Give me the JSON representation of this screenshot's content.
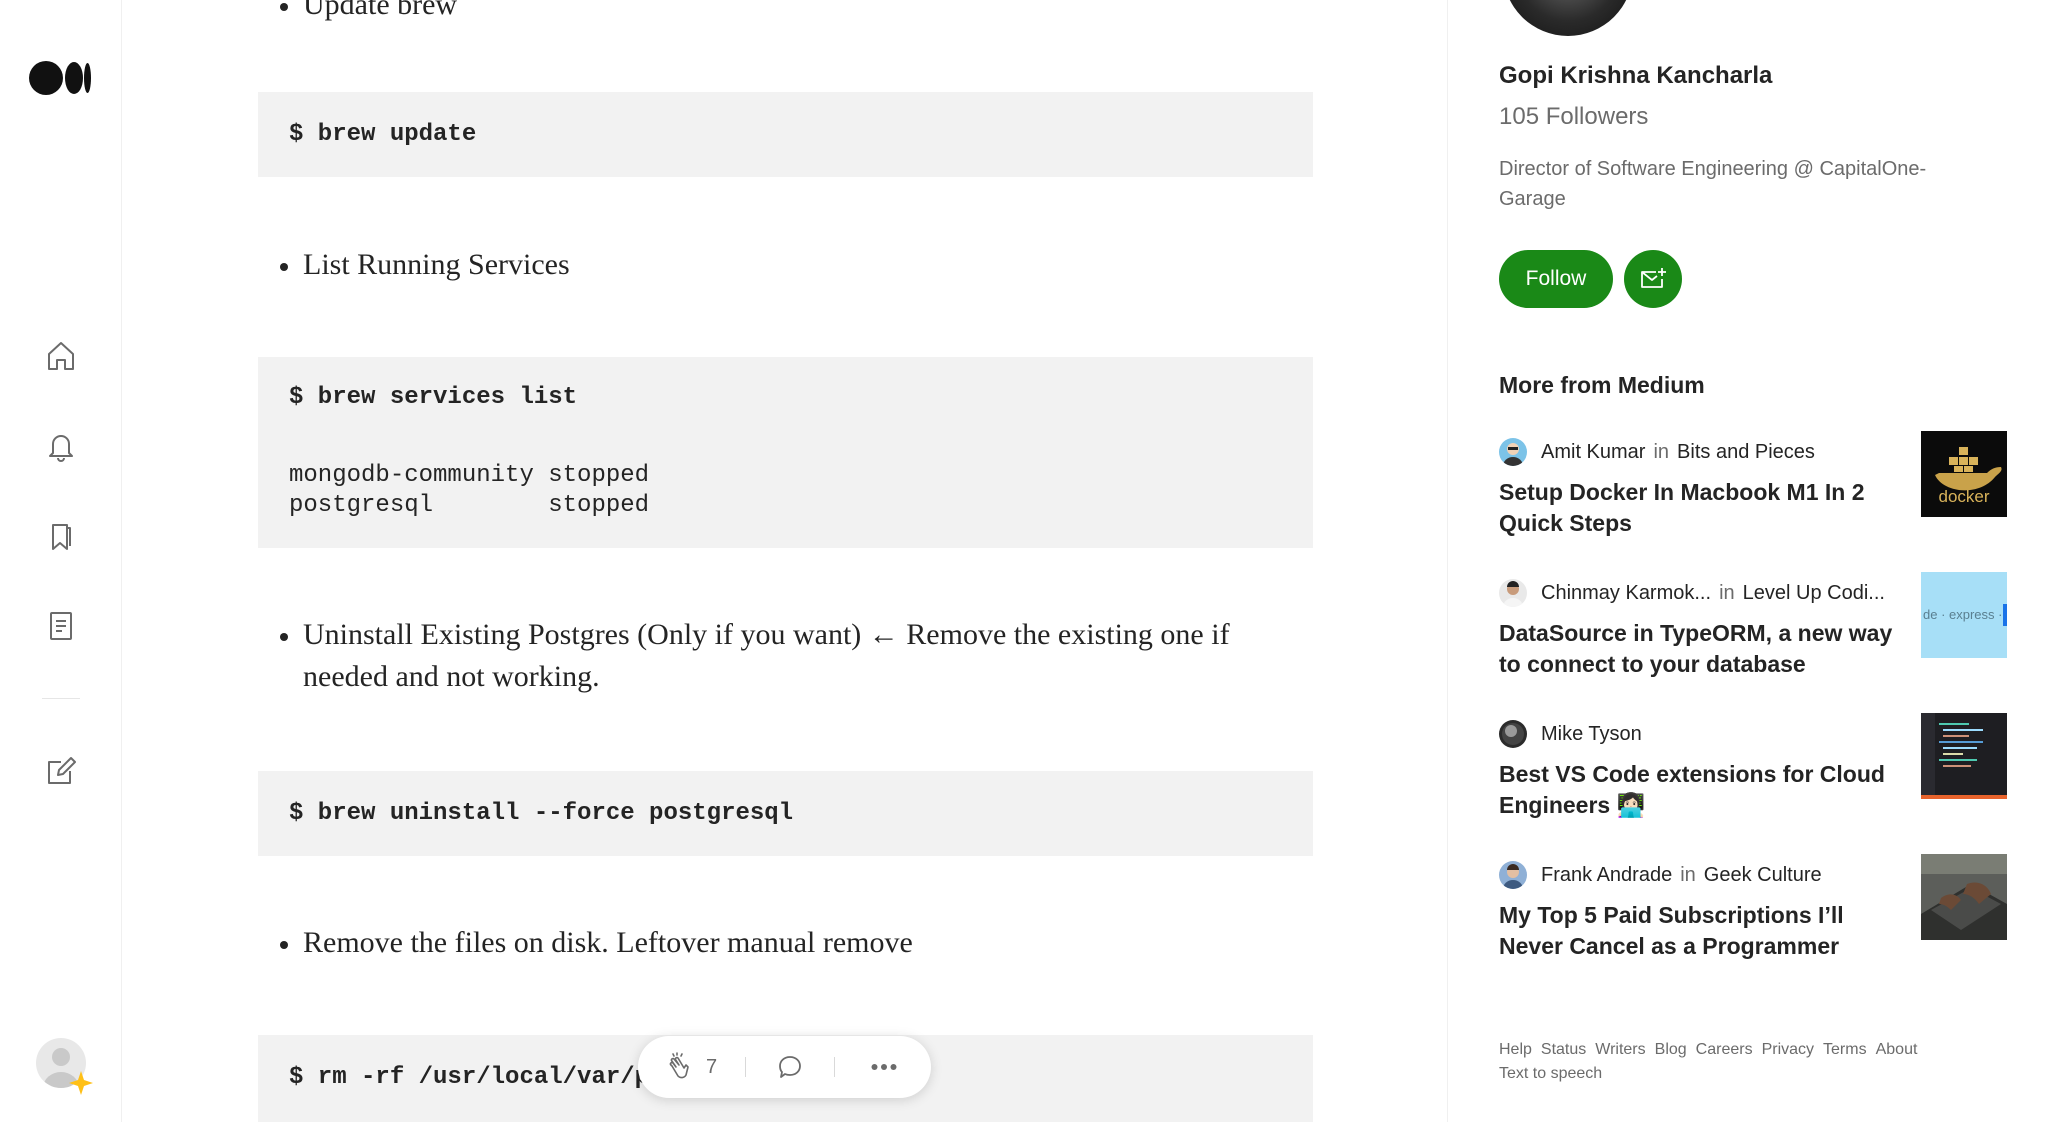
{
  "article": {
    "bullet_update": "Update brew",
    "code_update": "$ brew update",
    "bullet_list": "List Running Services",
    "code_list_cmd": "$ brew services list",
    "code_list_out_1": "mongodb-community stopped",
    "code_list_out_2": "postgresql        stopped",
    "bullet_uninstall": "Uninstall Existing Postgres (Only if you want) ← Remove the existing one if needed and not working.",
    "code_uninstall": "$ brew uninstall --force postgresql",
    "bullet_remove": "Remove the files on disk. Leftover manual remove",
    "code_rm": "$ rm -rf /usr/local/var/p"
  },
  "actionbar": {
    "clap_count": "7"
  },
  "sidebar": {
    "author_name": "Gopi Krishna Kancharla",
    "followers": "105 Followers",
    "bio": "Director of Software Engineering @ CapitalOne-Garage",
    "follow_label": "Follow",
    "more_title": "More from Medium",
    "accent_color": "#1a8917",
    "recommendations": [
      {
        "author": "Amit Kumar",
        "in": "in",
        "publication": "Bits and Pieces",
        "title": "Setup Docker In Macbook M1 In 2 Quick Steps",
        "thumb_text": "docker"
      },
      {
        "author": "Chinmay Karmok...",
        "in": "in",
        "publication": "Level Up Codi...",
        "title": "DataSource in TypeORM, a new way to connect to your database",
        "thumb_text": "de · express ·"
      },
      {
        "author": "Mike Tyson",
        "in": "",
        "publication": "",
        "title": "Best VS Code extensions for Cloud Engineers 👩🏻‍💻",
        "thumb_text": ""
      },
      {
        "author": "Frank Andrade",
        "in": "in",
        "publication": "Geek Culture",
        "title": "My Top 5 Paid Subscriptions I’ll Never Cancel as a Programmer",
        "thumb_text": ""
      }
    ],
    "footer_links": [
      "Help",
      "Status",
      "Writers",
      "Blog",
      "Careers",
      "Privacy",
      "Terms",
      "About",
      "Text to speech"
    ]
  }
}
